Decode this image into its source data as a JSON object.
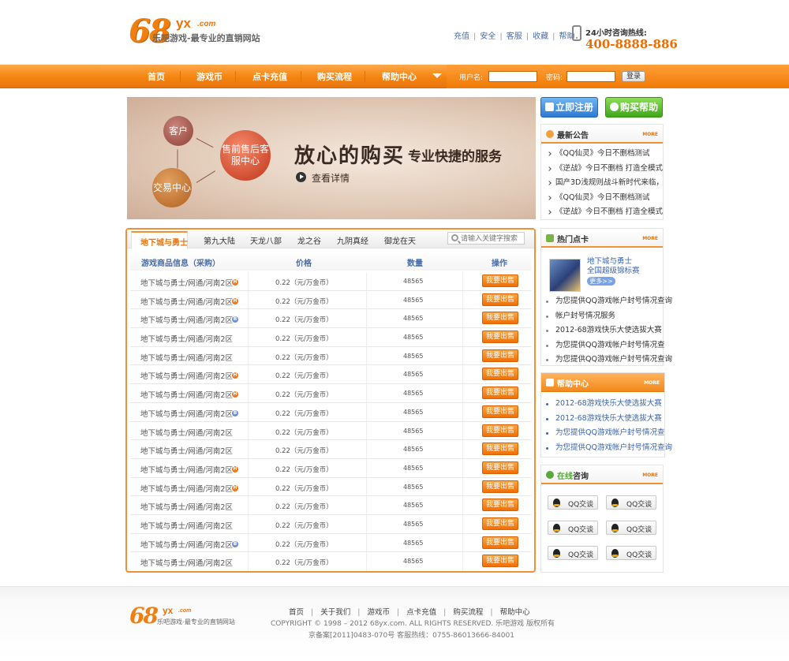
{
  "header": {
    "logo": {
      "num": "68",
      "yx": "yx",
      "com": ".com",
      "slogan": "乐吧游戏-最专业的直销网站"
    },
    "top_links": [
      "充值",
      "安全",
      "客服",
      "收藏",
      "帮助"
    ],
    "hotline_label": "24小时咨询热线:",
    "hotline_number": "400-8888-886"
  },
  "nav": {
    "items": [
      "首页",
      "游戏币",
      "点卡充值",
      "购买流程",
      "帮助中心"
    ],
    "username_label": "用户名:",
    "password_label": "密码:",
    "login_button": "登录"
  },
  "banner": {
    "circle_customer": "客户",
    "circle_trade": "交易中心",
    "circle_service": "售前售后客服中心",
    "title": "放心的购买",
    "subtitle": "专业快捷的服务",
    "more": "查看详情"
  },
  "products": {
    "tabs": [
      "地下城与勇士",
      "第九大陆",
      "天龙八部",
      "龙之谷",
      "九阴真经",
      "御龙在天"
    ],
    "search_placeholder": "请输入关键字搜索",
    "columns": [
      "游戏商品信息（采购）",
      "价格",
      "数量",
      "操作"
    ],
    "rows": [
      {
        "name": "地下城与勇士/网通/河南2区",
        "badge": "H",
        "price": "0.22（元/万金币）",
        "qty": "48565",
        "action": "我要出售"
      },
      {
        "name": "地下城与勇士/网通/河南2区",
        "badge": "H",
        "price": "0.22（元/万金币）",
        "qty": "48565",
        "action": "我要出售"
      },
      {
        "name": "地下城与勇士/网通/河南2区",
        "badge": "B",
        "price": "0.22（元/万金币）",
        "qty": "48565",
        "action": "我要出售"
      },
      {
        "name": "地下城与勇士/网通/河南2区",
        "badge": "",
        "price": "0.22（元/万金币）",
        "qty": "48565",
        "action": "我要出售"
      },
      {
        "name": "地下城与勇士/网通/河南2区",
        "badge": "",
        "price": "0.22（元/万金币）",
        "qty": "48565",
        "action": "我要出售"
      },
      {
        "name": "地下城与勇士/网通/河南2区",
        "badge": "H",
        "price": "0.22（元/万金币）",
        "qty": "48565",
        "action": "我要出售"
      },
      {
        "name": "地下城与勇士/网通/河南2区",
        "badge": "H",
        "price": "0.22（元/万金币）",
        "qty": "48565",
        "action": "我要出售"
      },
      {
        "name": "地下城与勇士/网通/河南2区",
        "badge": "B",
        "price": "0.22（元/万金币）",
        "qty": "48565",
        "action": "我要出售"
      },
      {
        "name": "地下城与勇士/网通/河南2区",
        "badge": "",
        "price": "0.22（元/万金币）",
        "qty": "48565",
        "action": "我要出售"
      },
      {
        "name": "地下城与勇士/网通/河南2区",
        "badge": "",
        "price": "0.22（元/万金币）",
        "qty": "48565",
        "action": "我要出售"
      },
      {
        "name": "地下城与勇士/网通/河南2区",
        "badge": "H",
        "price": "0.22（元/万金币）",
        "qty": "48565",
        "action": "我要出售"
      },
      {
        "name": "地下城与勇士/网通/河南2区",
        "badge": "H",
        "price": "0.22（元/万金币）",
        "qty": "48565",
        "action": "我要出售"
      },
      {
        "name": "地下城与勇士/网通/河南2区",
        "badge": "",
        "price": "0.22（元/万金币）",
        "qty": "48565",
        "action": "我要出售"
      },
      {
        "name": "地下城与勇士/网通/河南2区",
        "badge": "",
        "price": "0.22（元/万金币）",
        "qty": "48565",
        "action": "我要出售"
      },
      {
        "name": "地下城与勇士/网通/河南2区",
        "badge": "B",
        "price": "0.22（元/万金币）",
        "qty": "48565",
        "action": "我要出售"
      },
      {
        "name": "地下城与勇士/网通/河南2区",
        "badge": "",
        "price": "0.22（元/万金币）",
        "qty": "48565",
        "action": "我要出售"
      }
    ]
  },
  "sidebar": {
    "register_button": "立即注册",
    "help_button": "购买帮助",
    "more_label": "MORE",
    "announcements": {
      "title": "最新公告",
      "items": [
        "《QQ仙灵》今日不删档测试",
        "《逆战》今日不删档  打造全模式",
        "国产3D浅规则战斗新时代来临，",
        "《QQ仙灵》今日不删档测试",
        "《逆战》今日不删档  打造全模式"
      ]
    },
    "hot_cards": {
      "title": "热门点卡",
      "featured_title": "地下城与勇士",
      "featured_sub": "全国超级锦标赛",
      "featured_more": "更多>>",
      "items": [
        "为您提供QQ游戏帐户封号情况查询",
        "帐户封号情况服务",
        "2012-68游戏快乐大使选拔大赛",
        "为您提供QQ游戏帐户封号情况查",
        "为您提供QQ游戏帐户封号情况查询"
      ]
    },
    "help_center": {
      "title": "帮助中心",
      "items": [
        "2012-68游戏快乐大使选拔大赛",
        "2012-68游戏快乐大使选拔大赛",
        "为您提供QQ游戏帐户封号情况查",
        "为您提供QQ游戏帐户封号情况查询"
      ]
    },
    "online": {
      "title_prefix": "在线",
      "title_suffix": "咨询",
      "qq_label": "QQ交谈"
    }
  },
  "footer": {
    "links": [
      "首页",
      "关于我们",
      "游戏币",
      "点卡充值",
      "购买流程",
      "帮助中心"
    ],
    "copyright": "COPYRIGHT © 1998 – 2012 68yx.com. ALL RIGHTS RESERVED.    乐吧游戏  版权所有",
    "icp": "京备案[2011]0483-070号   客服热线：0755-86013666-84001"
  }
}
